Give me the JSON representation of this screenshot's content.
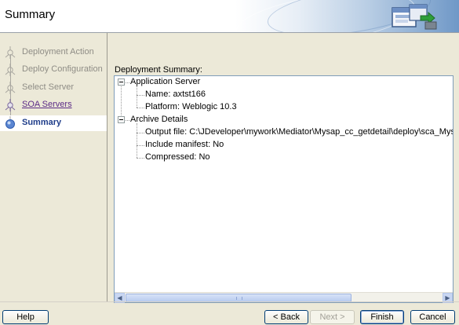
{
  "header": {
    "title": "Summary",
    "icon": "deployment-wizard-icon"
  },
  "nav": {
    "items": [
      {
        "label": "Deployment Action",
        "state": "disabled",
        "icon": "step-figure-icon"
      },
      {
        "label": "Deploy Configuration",
        "state": "disabled",
        "icon": "step-figure-icon"
      },
      {
        "label": "Select Server",
        "state": "disabled",
        "icon": "step-figure-icon"
      },
      {
        "label": "SOA Servers",
        "state": "link",
        "icon": "step-figure-icon"
      },
      {
        "label": "Summary",
        "state": "active",
        "icon": "current-step-icon"
      }
    ]
  },
  "main": {
    "label": "Deployment Summary:",
    "tree": {
      "nodes": [
        {
          "label": "Application Server",
          "expanded": true
        },
        {
          "label": "Name: axtst166"
        },
        {
          "label": "Platform: Weblogic 10.3"
        },
        {
          "label": "Archive Details",
          "expanded": true
        },
        {
          "label": "Output file: C:\\JDeveloper\\mywork\\Mediator\\Mysap_cc_getdetail\\deploy\\sca_Mysap_cc"
        },
        {
          "label": "Include manifest: No"
        },
        {
          "label": "Compressed: No"
        }
      ]
    }
  },
  "footer": {
    "help": "Help",
    "back": "< Back",
    "next": "Next >",
    "finish": "Finish",
    "cancel": "Cancel"
  },
  "colors": {
    "active_nav_text": "#1f3d8a",
    "link_nav_text": "#5b2a86",
    "disabled_text": "#8f8d86",
    "dialog_bg": "#ece9d8"
  }
}
